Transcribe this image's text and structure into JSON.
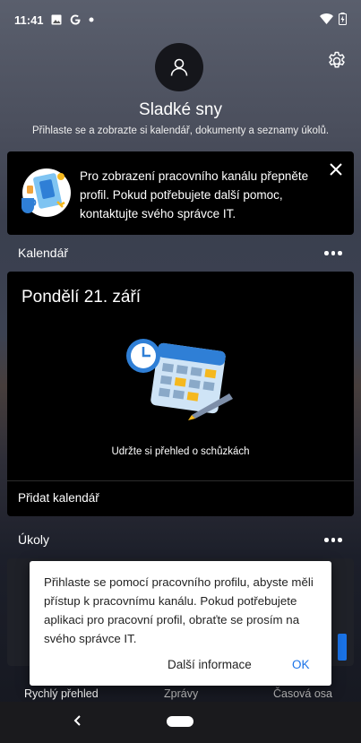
{
  "status_bar": {
    "time": "11:41",
    "left_icons": [
      "image-icon",
      "google-icon",
      "dot-icon"
    ],
    "right_icons": [
      "wifi-icon",
      "battery-icon"
    ]
  },
  "profile": {
    "name": "Sladké sny",
    "subtitle": "Přihlaste se a zobrazte si kalendář, dokumenty a seznamy úkolů."
  },
  "banner": {
    "text": "Pro zobrazení pracovního kanálu přepněte profil. Pokud potřebujete další pomoc, kontaktujte svého správce IT."
  },
  "calendar": {
    "section_title": "Kalendář",
    "date": "Pondělí 21. září",
    "hint": "Udržte si přehled o schůzkách",
    "add_label": "Přidat kalendář"
  },
  "tasks": {
    "section_title": "Úkoly"
  },
  "dialog": {
    "message": "Přihlaste se pomocí pracovního profilu, abyste měli přístup k pracovnímu kanálu. Pokud potřebujete aplikaci pro pracovní profil, obraťte se prosím na svého správce IT.",
    "more_label": "Další informace",
    "ok_label": "OK"
  },
  "bottom_nav": {
    "tabs": [
      "Rychlý přehled",
      "Zprávy",
      "Časová osa"
    ],
    "active_tab": "Rychlý přehled"
  },
  "colors": {
    "accent": "#1a73e8",
    "card_background": "#000000",
    "dialog_background": "#ffffff"
  }
}
